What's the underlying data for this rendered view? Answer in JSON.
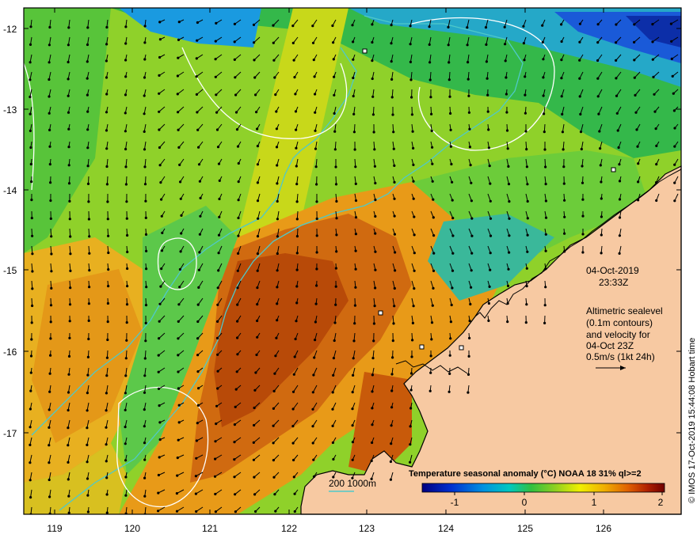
{
  "map": {
    "lon_ticks": [
      "119",
      "120",
      "121",
      "122",
      "123",
      "124",
      "125",
      "126"
    ],
    "lat_ticks": [
      "-12",
      "-13",
      "-14",
      "-15",
      "-16",
      "-17"
    ],
    "timestamp_date": "04-Oct-2019",
    "timestamp_time": "23:33Z",
    "altimetry_lines": [
      "Altimetric sealevel",
      "(0.1m contours)",
      "and velocity for",
      "04-Oct 23Z",
      "0.5m/s (1kt 24h)"
    ],
    "depth_legend": "200  1000m",
    "scale_title": "Temperature seasonal anomaly (°C) NOAA 18 31% ql>=2",
    "scale_ticks": [
      "-1",
      "0",
      "1",
      "2"
    ],
    "copyright": "© IMOS 17-Oct-2019 15:44:08 Hobart time",
    "colors": {
      "land": "#f7c9a2",
      "bathy": "#4fc9c9",
      "contour": "#ffffff",
      "frame": "#000000"
    }
  }
}
